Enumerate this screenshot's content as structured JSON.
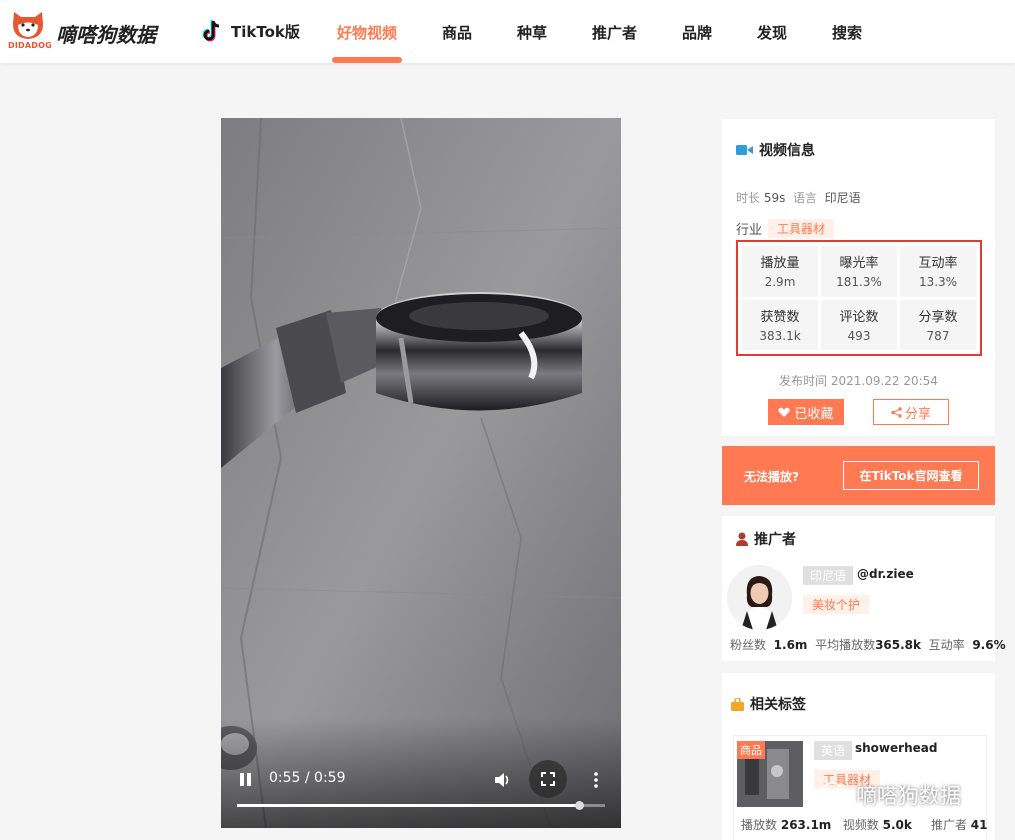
{
  "header": {
    "brand": "嘀嗒狗数据",
    "logo_sub": "DIDADOG",
    "tiktok": "TikTok版",
    "nav": [
      "好物视频",
      "商品",
      "种草",
      "推广者",
      "品牌",
      "发现",
      "搜索"
    ],
    "active_nav": "好物视频"
  },
  "video": {
    "time": "0:55 / 0:59",
    "progress": 0.93
  },
  "video_info": {
    "title": "视频信息",
    "duration_label": "时长",
    "duration": "59s",
    "language_label": "语言",
    "language": "印尼语",
    "industry_label": "行业",
    "industry": "工具器材",
    "stats": [
      {
        "label": "播放量",
        "value": "2.9m"
      },
      {
        "label": "曝光率",
        "value": "181.3%"
      },
      {
        "label": "互动率",
        "value": "13.3%"
      },
      {
        "label": "获赞数",
        "value": "383.1k"
      },
      {
        "label": "评论数",
        "value": "493"
      },
      {
        "label": "分享数",
        "value": "787"
      }
    ],
    "publish_time": "发布时间 2021.09.22 20:54",
    "favorite_label": "已收藏",
    "share_label": "分享"
  },
  "cta": {
    "text": "无法播放?",
    "button": "在TikTok官网查看"
  },
  "promoter": {
    "title": "推广者",
    "language": "印尼语",
    "handle": "@dr.ziee",
    "category": "美妆个护",
    "fans_label": "粉丝数",
    "fans": "1.6m",
    "avg_play_label": "平均播放数",
    "avg_play": "365.8k",
    "engagement_label": "互动率",
    "engagement": "9.6%"
  },
  "related_tags": {
    "title": "相关标签",
    "product": {
      "badge": "商品",
      "language": "英语",
      "name": "showerhead",
      "category": "工具器材",
      "plays_label": "播放数",
      "plays": "263.1m",
      "videos_label": "视频数",
      "videos": "5.0k",
      "promoters_label": "推广者",
      "promoters": "41"
    }
  },
  "watermark": "嘀嗒狗数据",
  "colors": {
    "accent": "#ff7a52",
    "highlight_border": "#e53935"
  }
}
